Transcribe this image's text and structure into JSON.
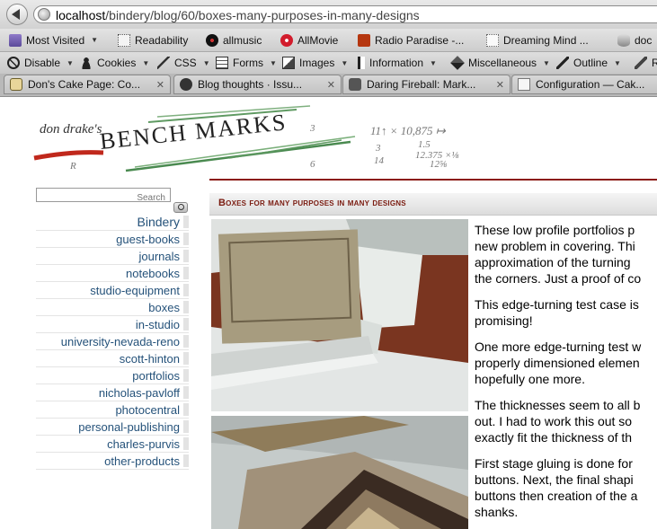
{
  "browser": {
    "url_host": "localhost",
    "url_path": "/bindery/blog/60/boxes-many-purposes-in-many-designs"
  },
  "bookmarks": [
    {
      "label": "Most Visited",
      "icon": "bookmarks-folder-icon",
      "dropdown": true
    },
    {
      "label": "Readability",
      "icon": "readability-icon",
      "dropdown": false
    },
    {
      "label": "allmusic",
      "icon": "vinyl-record-icon",
      "dropdown": false
    },
    {
      "label": "AllMovie",
      "icon": "film-reel-icon",
      "dropdown": false
    },
    {
      "label": "Radio Paradise -...",
      "icon": "radio-paradise-icon",
      "dropdown": false
    },
    {
      "label": "Dreaming Mind ...",
      "icon": "blank-page-icon",
      "dropdown": false
    },
    {
      "label": "doc",
      "icon": "database-icon",
      "dropdown": false
    }
  ],
  "webdev_toolbar": [
    {
      "label": "Disable",
      "icon": "disable-icon"
    },
    {
      "label": "Cookies",
      "icon": "person-icon"
    },
    {
      "label": "CSS",
      "icon": "magic-wand-icon"
    },
    {
      "label": "Forms",
      "icon": "form-icon"
    },
    {
      "label": "Images",
      "icon": "image-icon"
    },
    {
      "label": "Information",
      "icon": "info-icon"
    },
    {
      "label": "Miscellaneous",
      "icon": "cube-icon"
    },
    {
      "label": "Outline",
      "icon": "pencil-icon"
    },
    {
      "label": "R",
      "icon": "ruler-icon"
    }
  ],
  "tabs": [
    {
      "label": "Don's Cake Page: Co...",
      "icon": "cake-icon"
    },
    {
      "label": "Blog thoughts · Issu...",
      "icon": "github-icon"
    },
    {
      "label": "Daring Fireball: Mark...",
      "icon": "star-icon"
    },
    {
      "label": "Configuration — Cak...",
      "icon": "config-page-icon"
    }
  ],
  "site": {
    "banner_author": "don drake's",
    "banner_title": "BENCH MARKS",
    "search_placeholder": "Search",
    "nav": [
      "Bindery",
      "guest-books",
      "journals",
      "notebooks",
      "studio-equipment",
      "boxes",
      "in-studio",
      "university-nevada-reno",
      "scott-hinton",
      "portfolios",
      "nicholas-pavloff",
      "photocentral",
      "personal-publishing",
      "charles-purvis",
      "other-products"
    ]
  },
  "post": {
    "title": "Boxes for many purposes in many designs",
    "paragraphs": [
      "These low profile portfolios p\nnew problem in covering. Thi\napproximation of the turning\nthe corners. Just a proof of co",
      "This edge-turning test case is\npromising!",
      "One more edge-turning test w\nproperly dimensioned elemen\nhopefully one more.",
      "The thicknesses seem to all b\nout. I had to work this out so\nexactly fit the thickness of th",
      "First stage gluing is done for\nbuttons. Next, the final shapi\nbuttons then creation of the a\nshanks."
    ]
  },
  "colors": {
    "accent": "#8b1a12",
    "nav_link": "#25527a",
    "title": "#7a1b10"
  }
}
